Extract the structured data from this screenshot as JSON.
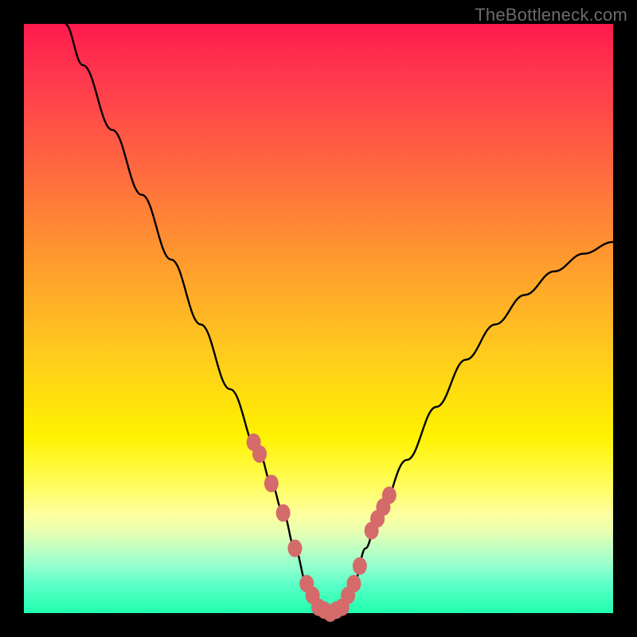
{
  "watermark": "TheBottleneck.com",
  "chart_data": {
    "type": "line",
    "title": "",
    "xlabel": "",
    "ylabel": "",
    "ylim": [
      0,
      100
    ],
    "xlim": [
      0,
      100
    ],
    "series": [
      {
        "name": "curve",
        "x": [
          7,
          10,
          15,
          20,
          25,
          30,
          35,
          40,
          42,
          44,
          46,
          48,
          50,
          52,
          54,
          56,
          58,
          60,
          65,
          70,
          75,
          80,
          85,
          90,
          95,
          100
        ],
        "values": [
          100,
          93,
          82,
          71,
          60,
          49,
          38,
          27,
          22,
          17,
          11,
          5,
          1,
          0,
          1,
          5,
          11,
          16,
          26,
          35,
          43,
          49,
          54,
          58,
          61,
          63
        ]
      },
      {
        "name": "highlight-markers",
        "x": [
          39,
          40,
          42,
          44,
          46,
          48,
          49,
          50,
          51,
          52,
          53,
          54,
          55,
          56,
          57,
          59,
          60,
          61,
          62
        ],
        "values": [
          29,
          27,
          22,
          17,
          11,
          5,
          3,
          1,
          0.5,
          0,
          0.5,
          1,
          3,
          5,
          8,
          14,
          16,
          18,
          20
        ]
      }
    ],
    "colors": {
      "curve": "#000000",
      "markers": "#d46a6a",
      "gradient_top": "#ff1a4d",
      "gradient_bottom": "#1effae"
    }
  }
}
